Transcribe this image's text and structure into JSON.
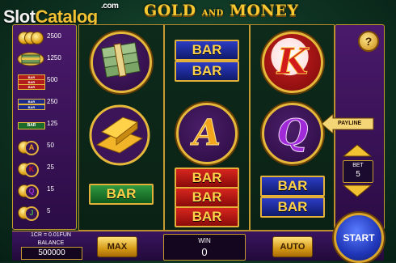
{
  "watermark": {
    "part1": "Slot",
    "part2": "Catalog",
    "suffix": ".com"
  },
  "title": {
    "word1": "GOLD",
    "connector": "AND",
    "word2": "MONEY"
  },
  "paytable": [
    {
      "symbol": "coin-stack-icon",
      "value": "2500"
    },
    {
      "symbol": "money-stack-icon",
      "value": "1250"
    },
    {
      "symbol": "triple-bar-red-icon",
      "value": "500",
      "bar_text": "BAR"
    },
    {
      "symbol": "triple-bar-blue-icon",
      "value": "250",
      "bar_text": "BAR"
    },
    {
      "symbol": "single-bar-green-icon",
      "value": "125",
      "bar_text": "BAR"
    },
    {
      "symbol": "letter-a-icon",
      "value": "50",
      "letter": "A"
    },
    {
      "symbol": "letter-k-icon",
      "value": "25",
      "letter": "K"
    },
    {
      "symbol": "letter-q-icon",
      "value": "15",
      "letter": "Q"
    },
    {
      "symbol": "letter-j-icon",
      "value": "5",
      "letter": "J"
    }
  ],
  "reels": {
    "reel1": {
      "top": "money-stack-icon",
      "middle": "gold-bars-icon",
      "bottom": "BAR"
    },
    "reel2": {
      "top_bar": "BAR",
      "middle_letter": "A",
      "bottom_bar": "BAR"
    },
    "reel3": {
      "top_letter": "K",
      "middle_letter": "Q",
      "bottom_bar": "BAR"
    }
  },
  "controls": {
    "help_label": "?",
    "payline_label": "PAYLINE",
    "bet_label": "BET",
    "bet_value": "5",
    "info_text": "1CR = 0.01FUN",
    "balance_label": "BALANCE",
    "balance_value": "500000",
    "max_label": "MAX",
    "win_label": "WIN",
    "win_value": "0",
    "auto_label": "AUTO",
    "start_label": "START"
  },
  "colors": {
    "gold": "#e3b13a",
    "purple_panel": "#4a1a6b",
    "felt_green": "#0e3322",
    "start_blue": "#2036b8"
  }
}
